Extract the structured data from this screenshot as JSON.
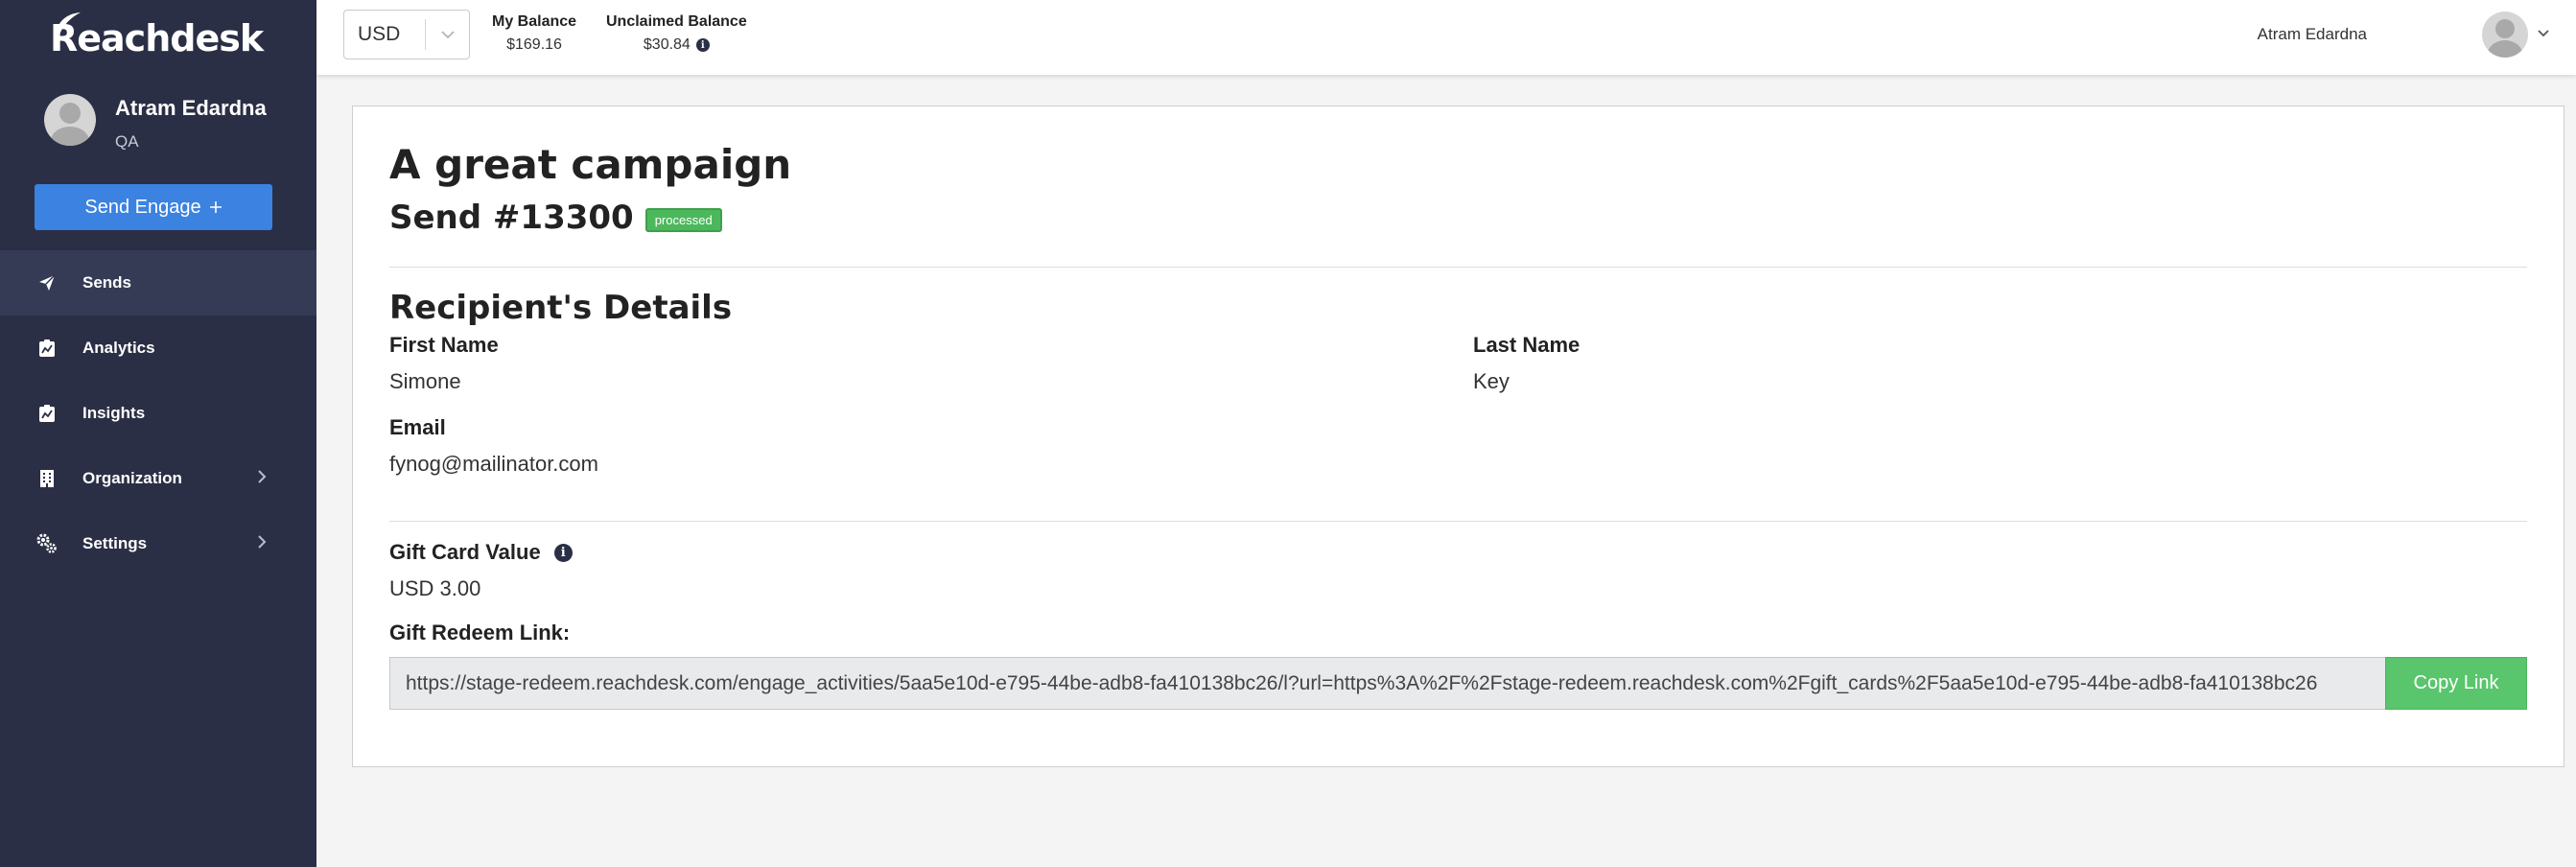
{
  "app": {
    "logo_text": "Reachdesk"
  },
  "sidebar": {
    "profile": {
      "name": "Atram Edardna",
      "role": "QA"
    },
    "send_engage_label": "Send Engage",
    "send_engage_icon": "plus-icon",
    "items": [
      {
        "label": "Sends",
        "icon": "paper-plane-icon",
        "active": true,
        "has_submenu": false
      },
      {
        "label": "Analytics",
        "icon": "chart-clipboard-icon",
        "active": false,
        "has_submenu": false
      },
      {
        "label": "Insights",
        "icon": "chart-clipboard-icon",
        "active": false,
        "has_submenu": false
      },
      {
        "label": "Organization",
        "icon": "building-icon",
        "active": false,
        "has_submenu": true
      },
      {
        "label": "Settings",
        "icon": "gears-icon",
        "active": false,
        "has_submenu": true
      }
    ],
    "colors": {
      "background": "#2a2f45",
      "active_item": "#353b55",
      "button": "#3c82e0"
    }
  },
  "header": {
    "currency": "USD",
    "my_balance": {
      "label": "My Balance",
      "value": "$169.16"
    },
    "unclaimed_balance": {
      "label": "Unclaimed Balance",
      "value": "$30.84"
    },
    "user_name": "Atram Edardna"
  },
  "main": {
    "campaign_title": "A great campaign",
    "send_title": "Send #13300",
    "status": "processed",
    "recipient": {
      "section_title": "Recipient's Details",
      "first_name_label": "First Name",
      "first_name": "Simone",
      "last_name_label": "Last Name",
      "last_name": "Key",
      "email_label": "Email",
      "email": "fynog@mailinator.com"
    },
    "gift": {
      "value_label": "Gift Card Value",
      "value": "USD 3.00",
      "redeem_label": "Gift Redeem Link:",
      "redeem_link": "https://stage-redeem.reachdesk.com/engage_activities/5aa5e10d-e795-44be-adb8-fa410138bc26/l?url=https%3A%2F%2Fstage-redeem.reachdesk.com%2Fgift_cards%2F5aa5e10d-e795-44be-adb8-fa410138bc26",
      "copy_label": "Copy Link"
    },
    "colors": {
      "status_badge": "#4cb85c",
      "copy_button": "#59c56c"
    }
  }
}
